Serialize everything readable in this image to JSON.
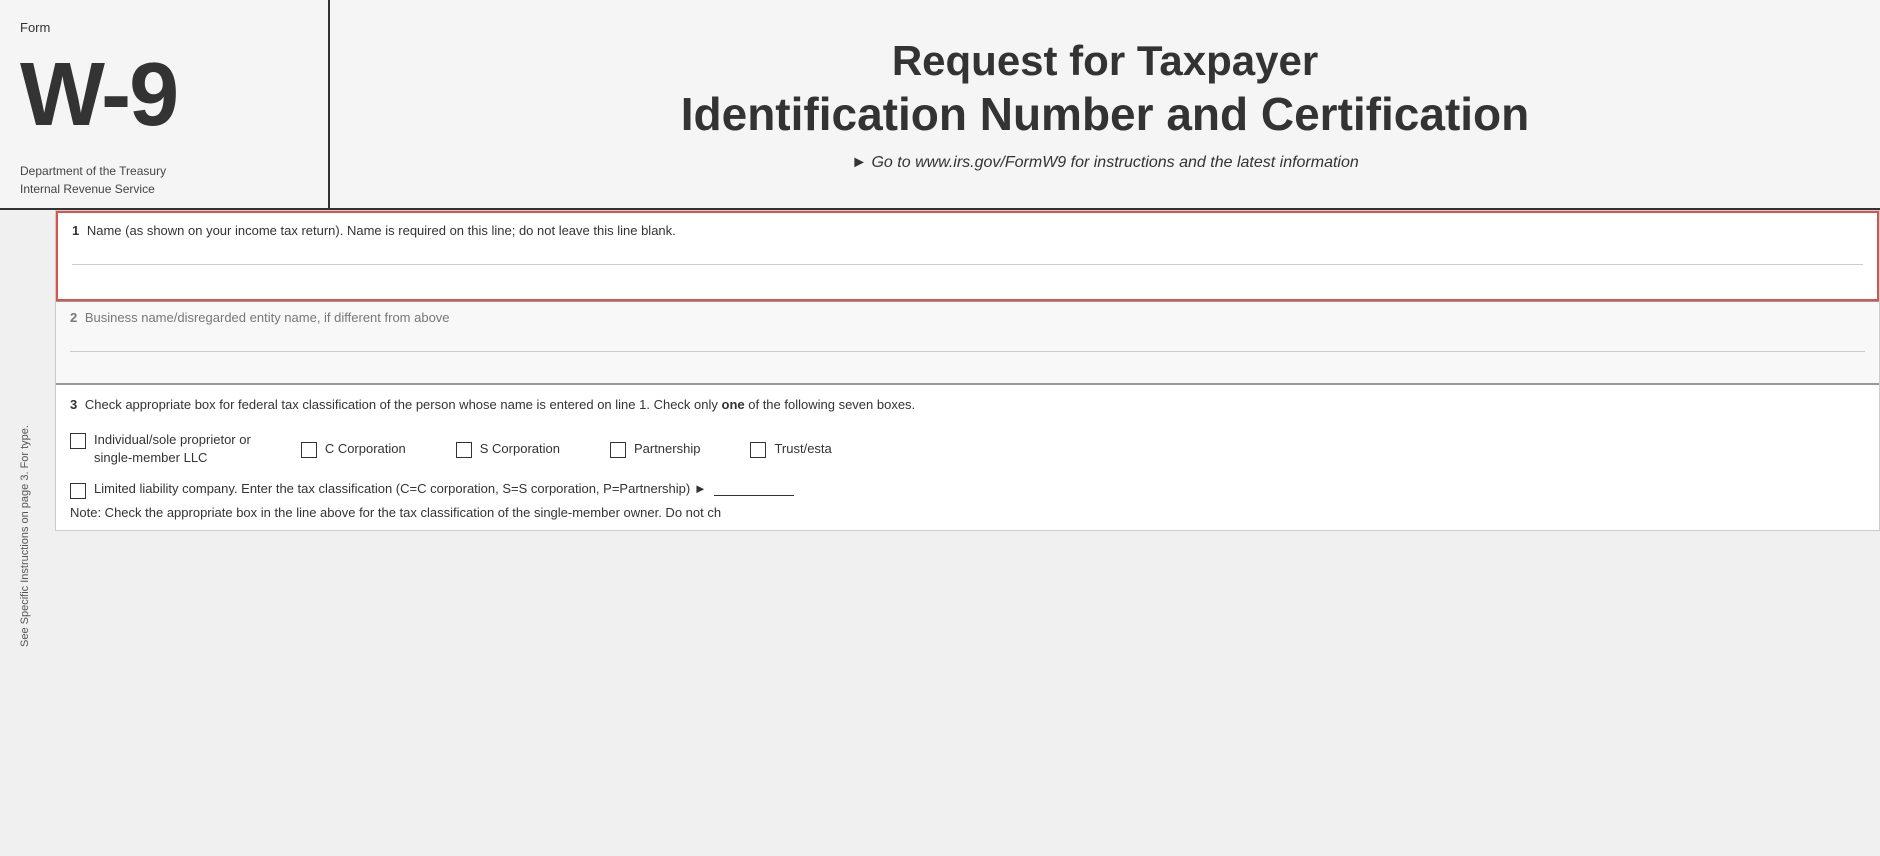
{
  "header": {
    "form_label": "Form",
    "form_number": "W-9",
    "dept_line1": "Department of the Treasury",
    "dept_line2": "Internal Revenue Service",
    "title_line1": "Request for Taxpayer",
    "title_line2": "Identification Number and Certification",
    "instruction": "► Go to www.irs.gov/FormW9 for instructions and the latest information"
  },
  "sidebar": {
    "text": "See Specific Instructions on page 3. For type."
  },
  "fields": {
    "field1": {
      "number": "1",
      "label": "Name (as shown on your income tax return). Name is required on this line; do not leave this line blank."
    },
    "field2": {
      "number": "2",
      "label": "Business name/disregarded entity name, if different from above"
    },
    "field3": {
      "number": "3",
      "header": "Check appropriate box for federal tax classification of the person whose name is entered on line 1. Check only one of the following seven boxes.",
      "checkboxes": [
        {
          "id": "individual",
          "label": "Individual/sole proprietor or\nsingle-member LLC"
        },
        {
          "id": "c_corp",
          "label": "C Corporation"
        },
        {
          "id": "s_corp",
          "label": "S Corporation"
        },
        {
          "id": "partnership",
          "label": "Partnership"
        },
        {
          "id": "trust",
          "label": "Trust/esta"
        }
      ],
      "llc_text": "Limited liability company. Enter the tax classification (C=C corporation, S=S corporation, P=Partnership) ►",
      "note": "Note: Check the appropriate box in the line above for the tax classification of the single-member owner.  Do not ch"
    }
  }
}
